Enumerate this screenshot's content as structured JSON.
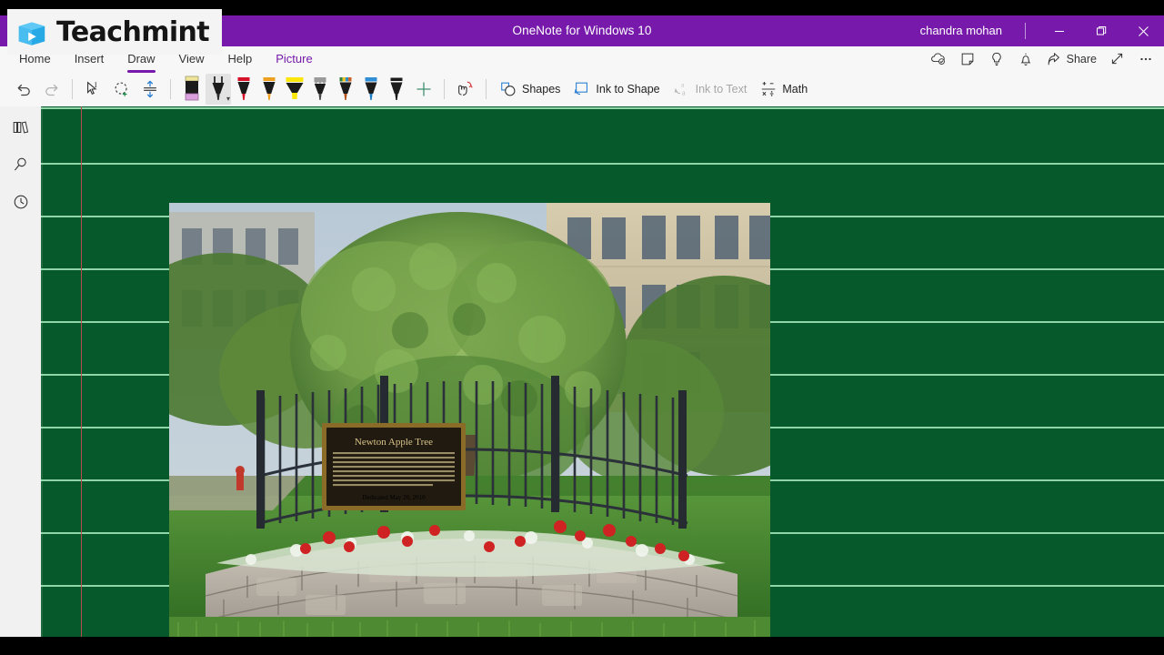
{
  "window": {
    "title": "OneNote for Windows 10",
    "account": "chandra mohan",
    "minimize_label": "Minimize",
    "maximize_label": "Restore",
    "close_label": "Close"
  },
  "brand": {
    "name": "Teachmint",
    "logo_icon": "open-book-play-icon"
  },
  "ribbon": {
    "tabs": [
      {
        "label": "Home",
        "active": false,
        "contextual": false
      },
      {
        "label": "Insert",
        "active": false,
        "contextual": false
      },
      {
        "label": "Draw",
        "active": true,
        "contextual": false
      },
      {
        "label": "View",
        "active": false,
        "contextual": false
      },
      {
        "label": "Help",
        "active": false,
        "contextual": false
      },
      {
        "label": "Picture",
        "active": false,
        "contextual": true
      }
    ],
    "right_actions": [
      {
        "label": "",
        "icon": "cloud-sync-icon"
      },
      {
        "label": "",
        "icon": "sticky-note-icon"
      },
      {
        "label": "",
        "icon": "lightbulb-icon"
      },
      {
        "label": "",
        "icon": "bell-icon"
      },
      {
        "label": "Share",
        "icon": "share-icon"
      },
      {
        "label": "",
        "icon": "expand-arrow-icon"
      },
      {
        "label": "",
        "icon": "more-options-icon"
      }
    ]
  },
  "toolbar": {
    "undo_label": "Undo",
    "redo_label": "Redo",
    "select_label": "Select objects or type text",
    "lasso_label": "Lasso Select",
    "insert_space_label": "Insert Space",
    "eraser_label": "Eraser",
    "add_pen_label": "Add Pen",
    "shapes_label": "Shapes",
    "ink_to_shape_label": "Ink to Shape",
    "ink_to_text_label": "Ink to Text",
    "math_label": "Math",
    "pens": [
      {
        "name": "pen-selected-black",
        "body": "#1b1b1b",
        "cap": "#f2f2f2",
        "tip": "#2b2b2b",
        "type": "pen",
        "selected": true
      },
      {
        "name": "pen-red",
        "body": "#1b1b1b",
        "cap": "#d51028",
        "tip": "#d51028",
        "type": "pen",
        "selected": false
      },
      {
        "name": "pen-orange",
        "body": "#1b1b1b",
        "cap": "#f0a020",
        "tip": "#f0a020",
        "type": "pen",
        "selected": false
      },
      {
        "name": "highlighter-yellow",
        "body": "#1b1b1b",
        "cap": "#fbe60a",
        "tip": "#fbe60a",
        "type": "highlighter",
        "selected": false
      },
      {
        "name": "pencil-grey",
        "body": "#1b1b1b",
        "cap": "#9a9a9a",
        "tip": "#4a4a4a",
        "type": "pencil",
        "selected": false
      },
      {
        "name": "pen-rainbow",
        "body": "#1b1b1b",
        "cap": "rainbow",
        "tip": "#b4531a",
        "type": "pen",
        "selected": false
      },
      {
        "name": "pen-blue",
        "body": "#1b1b1b",
        "cap": "#2e8fd6",
        "tip": "#1a7fc4",
        "type": "pen",
        "selected": false
      },
      {
        "name": "pen-black",
        "body": "#1b1b1b",
        "cap": "#1b1b1b",
        "tip": "#1b1b1b",
        "type": "pen",
        "selected": false
      }
    ]
  },
  "sidebar": {
    "items": [
      {
        "label": "Notebooks",
        "icon": "notebooks-icon"
      },
      {
        "label": "Search",
        "icon": "search-icon"
      },
      {
        "label": "Recent Notes",
        "icon": "clock-icon"
      }
    ]
  },
  "page": {
    "background_color": "#06592a",
    "rule_color": "#a8ebbe",
    "margin_color": "#b84a4a",
    "image": {
      "name": "newton-apple-tree-photo",
      "alt": "Photograph of the Newton Apple Tree enclosed by a black iron fence on a stone planter wall, with a stone building behind it",
      "plaque_title": "Newton Apple Tree",
      "plaque_footer": "Dedicated May 20, 2010"
    }
  }
}
